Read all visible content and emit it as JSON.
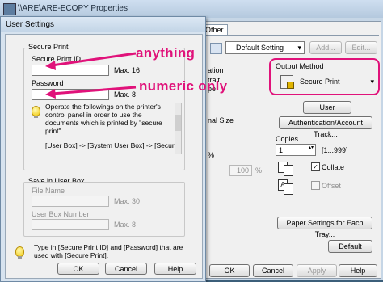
{
  "window": {
    "title": "\\\\ARE\\ARE-ECOPY Properties"
  },
  "tabs": [
    "Other"
  ],
  "favorites": {
    "selected": "Default Setting",
    "add": "Add...",
    "edit": "Edit..."
  },
  "behind": {
    "orientation_frag": "ation",
    "portrait_frag": "trait",
    "landscape_frag": "pe",
    "size_frag": "nal Size",
    "pct_frag": "%",
    "zoom_value": "100",
    "zoom_unit": "%"
  },
  "output_method": {
    "label": "Output Method",
    "selected": "Secure Print"
  },
  "buttons": {
    "user_settings": "User Settings...",
    "auth_track": "Authentication/Account Track...",
    "paper_settings": "Paper Settings for Each Tray...",
    "default": "Default"
  },
  "copies": {
    "label": "Copies",
    "value": "1",
    "range": "[1...999]",
    "collate": "Collate",
    "offset": "Offset"
  },
  "dialog": {
    "title": "User Settings",
    "secure_print": {
      "group": "Secure Print",
      "id_label": "Secure Print ID",
      "id_max": "Max. 16",
      "pw_label": "Password",
      "pw_max": "Max. 8",
      "info": "Operate the followings on the printer's control panel in order to use the documents which is printed by \"secure print\".",
      "path": "[User Box] -> [System User Box] -> [Secure Print"
    },
    "save_box": {
      "group": "Save in User Box",
      "file_label": "File Name",
      "file_max": "Max. 30",
      "box_label": "User Box Number",
      "box_max": "Max. 8"
    },
    "hint": "Type in [Secure Print ID] and [Password] that are used with [Secure Print].",
    "ok": "OK",
    "cancel": "Cancel",
    "help": "Help"
  },
  "bottom_buttons": {
    "ok": "OK",
    "cancel": "Cancel",
    "apply": "Apply",
    "help": "Help"
  },
  "annotations": {
    "anything": "anything",
    "numeric": "numeric only"
  },
  "colors": {
    "annotation": "#e0127a"
  }
}
